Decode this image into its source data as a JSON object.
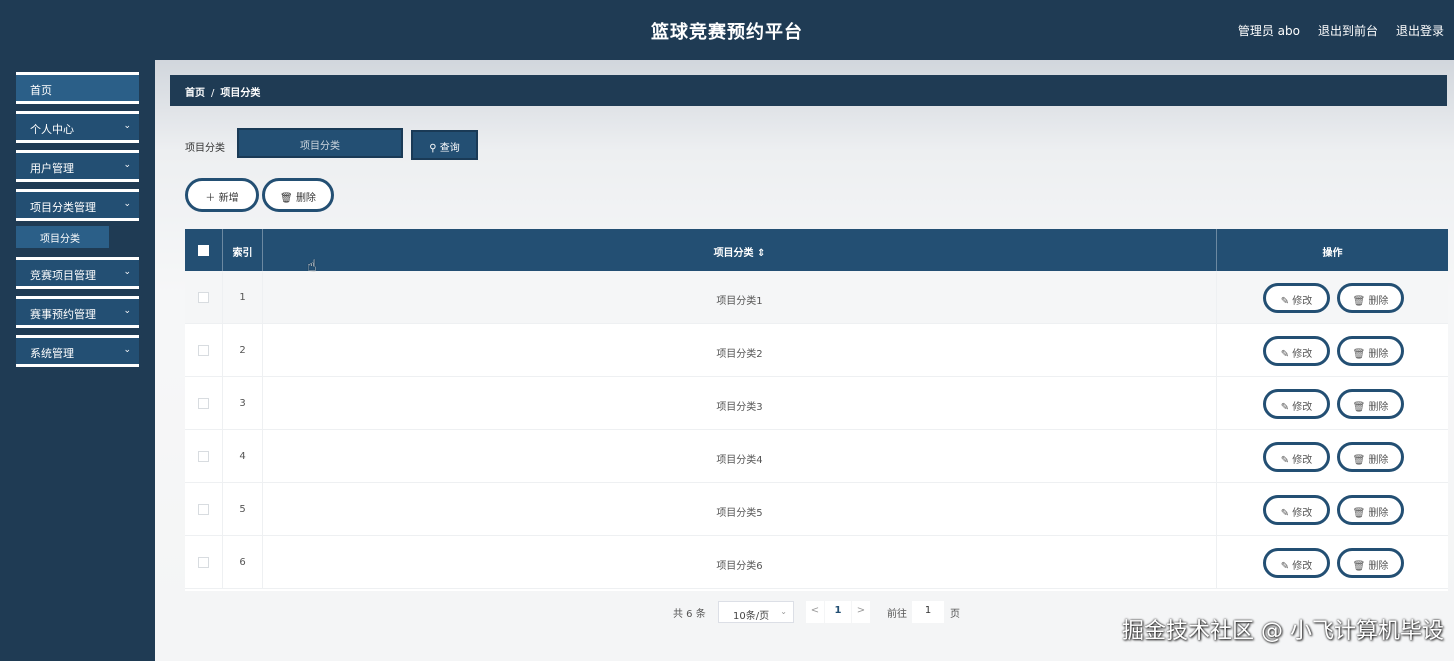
{
  "header": {
    "title": "篮球竞赛预约平台",
    "admin": "管理员 abo",
    "to_front": "退出到前台",
    "logout": "退出登录"
  },
  "sidebar": {
    "items": [
      {
        "label": "首页"
      },
      {
        "label": "个人中心"
      },
      {
        "label": "用户管理"
      },
      {
        "label": "项目分类管理"
      },
      {
        "label": "竞赛项目管理"
      },
      {
        "label": "赛事预约管理"
      },
      {
        "label": "系统管理"
      }
    ],
    "sub_active": "项目分类",
    "chevron": "⌄"
  },
  "breadcrumb": {
    "home": "首页",
    "sep": "/",
    "current": "项目分类"
  },
  "search": {
    "label": "项目分类",
    "placeholder": "项目分类",
    "button": "查询"
  },
  "actions": {
    "add": "新增",
    "delete": "删除"
  },
  "table": {
    "columns": [
      "索引",
      "项目分类 ⇕",
      "操作"
    ],
    "rows": [
      {
        "index": "1",
        "category": "项目分类1"
      },
      {
        "index": "2",
        "category": "项目分类2"
      },
      {
        "index": "3",
        "category": "项目分类3"
      },
      {
        "index": "4",
        "category": "项目分类4"
      },
      {
        "index": "5",
        "category": "项目分类5"
      },
      {
        "index": "6",
        "category": "项目分类6"
      }
    ],
    "edit_label": "修改",
    "delete_label": "删除"
  },
  "pager": {
    "total": "共 6 条",
    "page_size": "10条/页",
    "prev": "<",
    "current": "1",
    "next": ">",
    "goto": "前往",
    "goto_value": "1",
    "page_unit": "页"
  },
  "watermark": "掘金技术社区 @ 小飞计算机毕设",
  "colors": {
    "primary": "#234f73",
    "header": "#1f3b54"
  }
}
